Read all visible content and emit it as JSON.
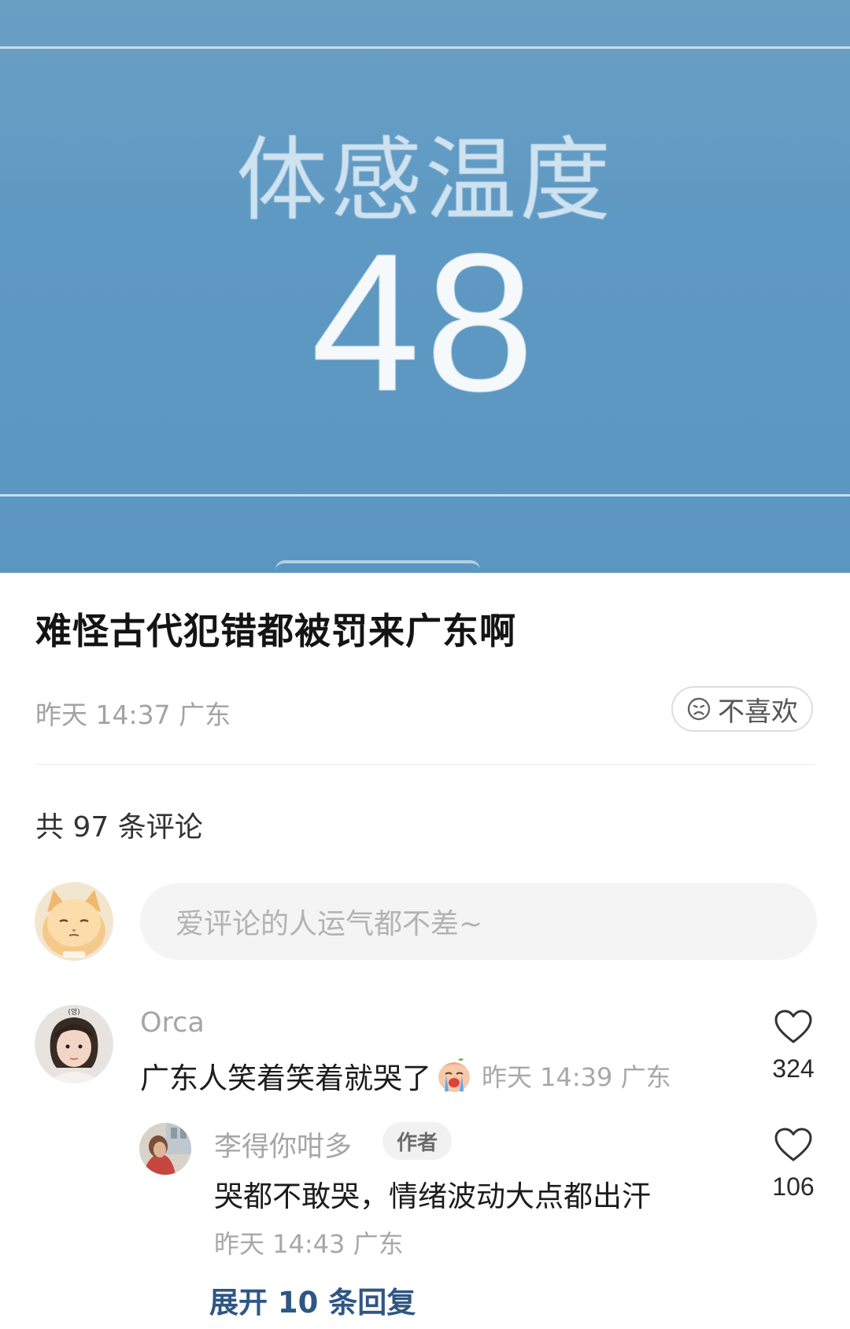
{
  "hero": {
    "label": "体感温度",
    "value": "48"
  },
  "post": {
    "title": "难怪古代犯错都被罚来广东啊",
    "time": "昨天 14:37",
    "location": "广东",
    "dislike_label": "不喜欢"
  },
  "comments_header": {
    "count_text": "共 97 条评论"
  },
  "composer": {
    "placeholder": "爱评论的人运气都不差~"
  },
  "comments": [
    {
      "user": "Orca",
      "text": "广东人笑着笑着就哭了",
      "emoji": "crying-baby-emoji",
      "time": "昨天 14:39",
      "location": "广东",
      "likes": "324",
      "replies": [
        {
          "user": "李得你咁多",
          "badge": "作者",
          "text": "哭都不敢哭，情绪波动大点都出汗",
          "time": "昨天 14:43",
          "location": "广东",
          "likes": "106"
        }
      ],
      "expand_label": "展开 10 条回复"
    }
  ],
  "colors": {
    "hero_bg": "#5e99c3",
    "link": "#2f5684",
    "meta": "#a8a8a8"
  },
  "icons": [
    "sad-face-icon",
    "heart-icon",
    "crying-baby-emoji"
  ]
}
